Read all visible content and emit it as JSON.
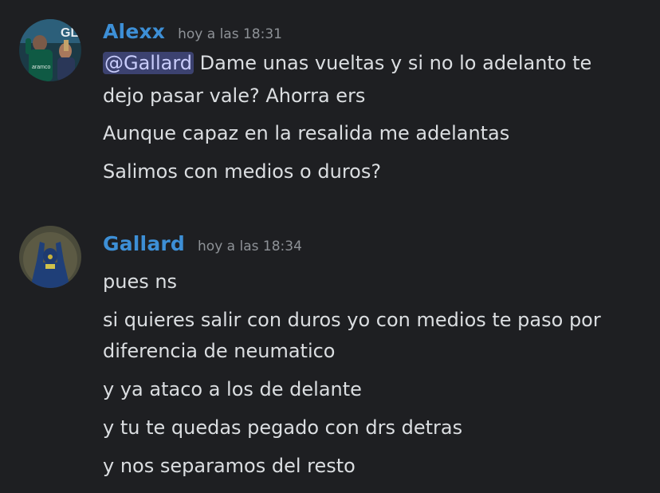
{
  "messages": [
    {
      "username": "Alexx",
      "timestamp": "hoy a las 18:31",
      "mention": "@Gallard",
      "lines": [
        " Dame unas vueltas y si no lo adelanto te",
        "dejo pasar vale? Ahorra ers",
        "Aunque capaz en la resalida me adelantas",
        "Salimos con medios o duros?"
      ]
    },
    {
      "username": "Gallard",
      "timestamp": "hoy a las 18:34",
      "lines": [
        "pues ns",
        "si quieres salir con duros yo con medios te paso por",
        "diferencia de neumatico",
        "y ya ataco a los de delante",
        "y tu te quedas pegado con drs detras",
        "y nos separamos del resto"
      ]
    }
  ],
  "colors": {
    "background": "#1e1f22",
    "username": "#3d8fd6",
    "mention_bg": "#3c4270"
  },
  "icons": [
    "avatar-alexx",
    "avatar-gallard"
  ]
}
